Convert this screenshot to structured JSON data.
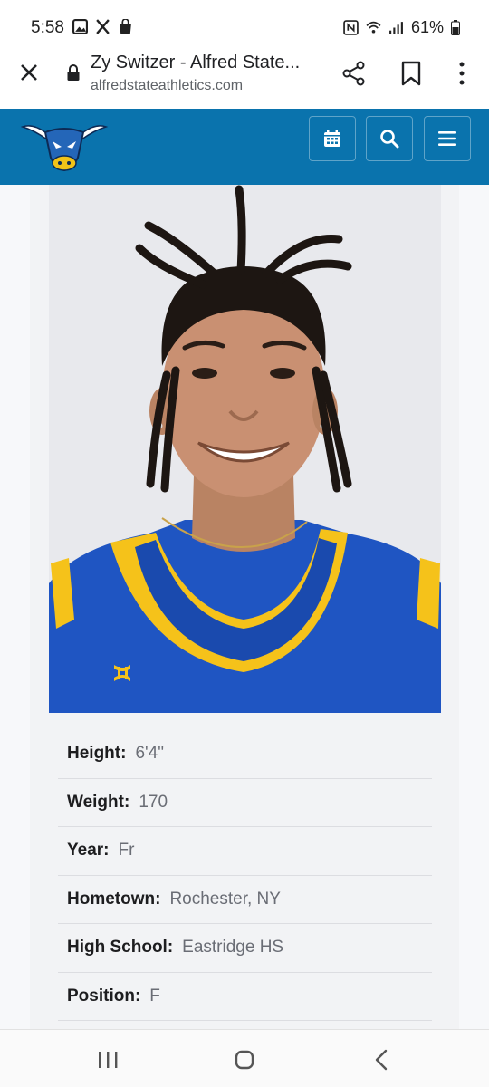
{
  "status_bar": {
    "time": "5:58",
    "battery": "61%",
    "left_icons": [
      "image-icon",
      "x-logo-icon",
      "shopping-bag-icon"
    ],
    "right_icons": [
      "nfc-icon",
      "wifi-icon",
      "signal-icon",
      "battery-icon"
    ]
  },
  "browser": {
    "title": "Zy Switzer - Alfred State...",
    "url": "alfredstateathletics.com"
  },
  "site_header": {
    "brand_color": "#0a73ad",
    "buttons": [
      "calendar-icon",
      "search-icon",
      "menu-icon"
    ]
  },
  "player": {
    "photo_alt": "Zy Switzer",
    "details": [
      {
        "label": "Height:",
        "value": "6'4\""
      },
      {
        "label": "Weight:",
        "value": "170"
      },
      {
        "label": "Year:",
        "value": "Fr"
      },
      {
        "label": "Hometown:",
        "value": "Rochester, NY"
      },
      {
        "label": "High School:",
        "value": "Eastridge HS"
      },
      {
        "label": "Position:",
        "value": "F"
      }
    ]
  },
  "colors": {
    "jersey_blue": "#1f4fb8",
    "jersey_gold": "#f5c21a"
  }
}
